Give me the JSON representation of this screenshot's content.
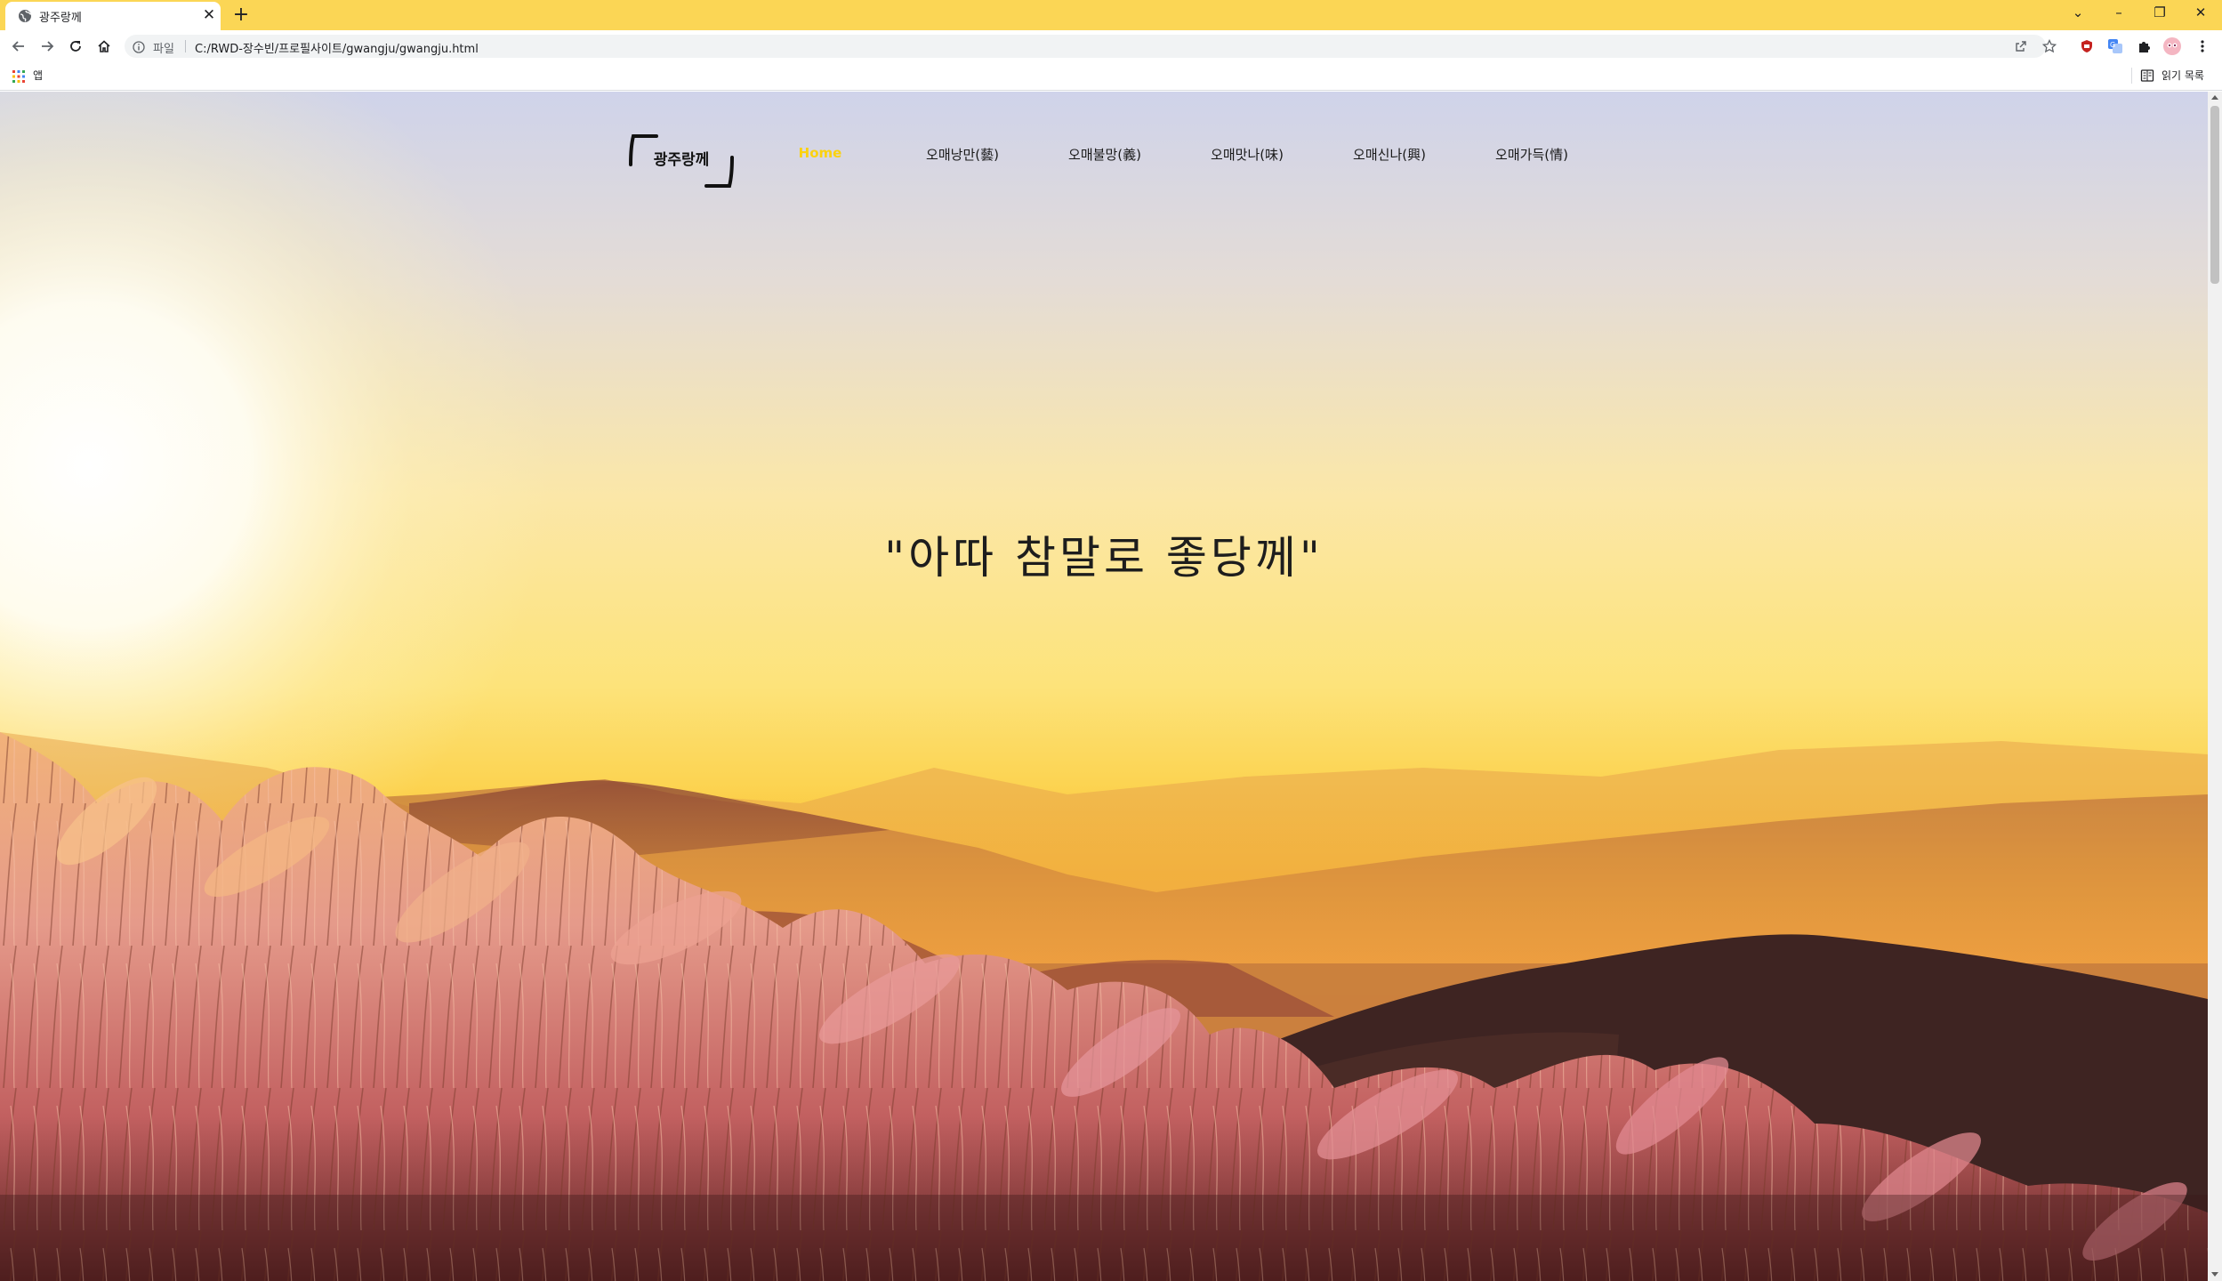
{
  "browser": {
    "tab_title": "광주랑께",
    "tab_close": "✕",
    "new_tab": "+",
    "window_controls": {
      "tabs_menu": "⌄",
      "minimize": "–",
      "restore": "❐",
      "close": "✕"
    },
    "address": {
      "scheme_label": "파일",
      "url": "C:/RWD-장수빈/프로필사이트/gwangju/gwangju.html"
    },
    "bookmarks": {
      "apps_label": "앱",
      "reading_list_label": "읽기 목록"
    }
  },
  "site": {
    "logo_text": "광주랑께",
    "nav": [
      {
        "label": "Home",
        "active": true
      },
      {
        "label": "오매낭만(藝)",
        "active": false
      },
      {
        "label": "오매불망(義)",
        "active": false
      },
      {
        "label": "오매맛나(味)",
        "active": false
      },
      {
        "label": "오매신나(興)",
        "active": false
      },
      {
        "label": "오매가득(情)",
        "active": false
      }
    ],
    "tagline": "\"아따 참말로 좋당께\""
  },
  "colors": {
    "tab_strip": "#fbd655",
    "nav_active": "#fbd20f",
    "text_dark": "#1a1a1a"
  },
  "icons": [
    "globe-icon",
    "back-arrow-icon",
    "forward-arrow-icon",
    "reload-icon",
    "home-icon",
    "info-icon",
    "share-icon",
    "star-icon",
    "shield-extension-icon",
    "translate-extension-icon",
    "puzzle-extensions-icon",
    "profile-avatar-icon",
    "kebab-menu-icon",
    "apps-grid-icon",
    "reading-list-icon"
  ]
}
